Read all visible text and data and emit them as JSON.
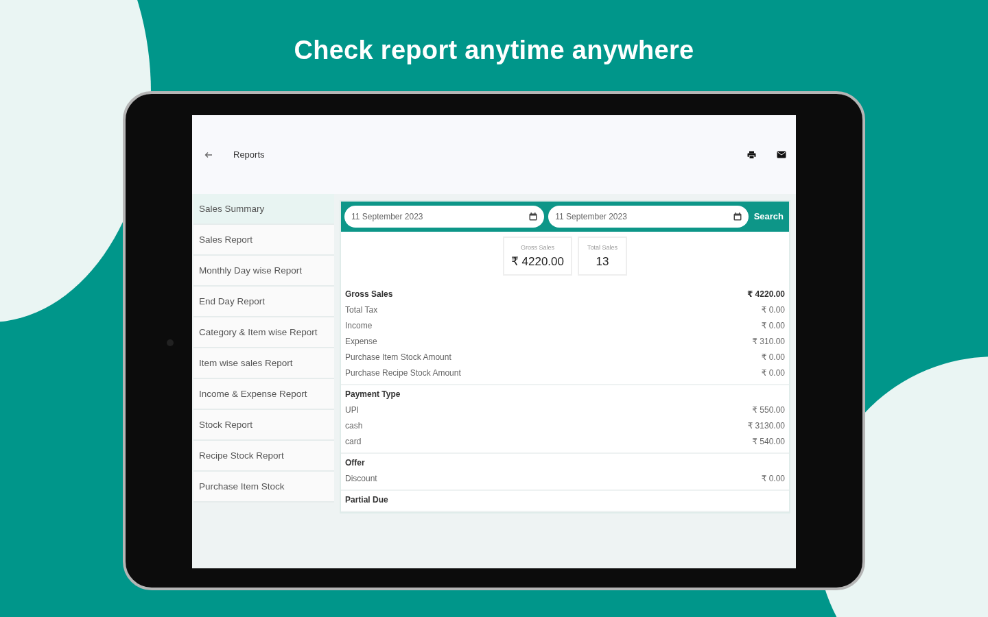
{
  "headline": "Check report anytime anywhere",
  "app_bar": {
    "title": "Reports"
  },
  "sidebar": {
    "items": [
      {
        "label": "Sales Summary",
        "selected": true
      },
      {
        "label": "Sales Report",
        "selected": false
      },
      {
        "label": "Monthly Day wise Report",
        "selected": false
      },
      {
        "label": "End Day Report",
        "selected": false
      },
      {
        "label": "Category & Item wise Report",
        "selected": false
      },
      {
        "label": "Item wise sales Report",
        "selected": false
      },
      {
        "label": "Income & Expense Report",
        "selected": false
      },
      {
        "label": "Stock Report",
        "selected": false
      },
      {
        "label": "Recipe Stock Report",
        "selected": false
      },
      {
        "label": "Purchase Item Stock",
        "selected": false
      }
    ]
  },
  "filter": {
    "from_date": "11 September 2023",
    "to_date": "11 September 2023",
    "search_label": "Search"
  },
  "summary_cards": [
    {
      "label": "Gross Sales",
      "value": "₹ 4220.00"
    },
    {
      "label": "Total Sales",
      "value": "13"
    }
  ],
  "sections": [
    {
      "title": "Gross Sales",
      "value": "₹ 4220.00",
      "rows": [
        {
          "label": "Total Tax",
          "value": "₹ 0.00"
        },
        {
          "label": "Income",
          "value": "₹ 0.00"
        },
        {
          "label": "Expense",
          "value": "₹ 310.00"
        },
        {
          "label": "Purchase Item Stock Amount",
          "value": "₹ 0.00"
        },
        {
          "label": "Purchase Recipe Stock Amount",
          "value": "₹ 0.00"
        }
      ]
    },
    {
      "title": "Payment Type",
      "rows": [
        {
          "label": "UPI",
          "value": "₹ 550.00"
        },
        {
          "label": "cash",
          "value": "₹ 3130.00"
        },
        {
          "label": "card",
          "value": "₹ 540.00"
        }
      ]
    },
    {
      "title": "Offer",
      "rows": [
        {
          "label": "Discount",
          "value": "₹ 0.00"
        }
      ]
    },
    {
      "title": "Partial Due"
    }
  ]
}
